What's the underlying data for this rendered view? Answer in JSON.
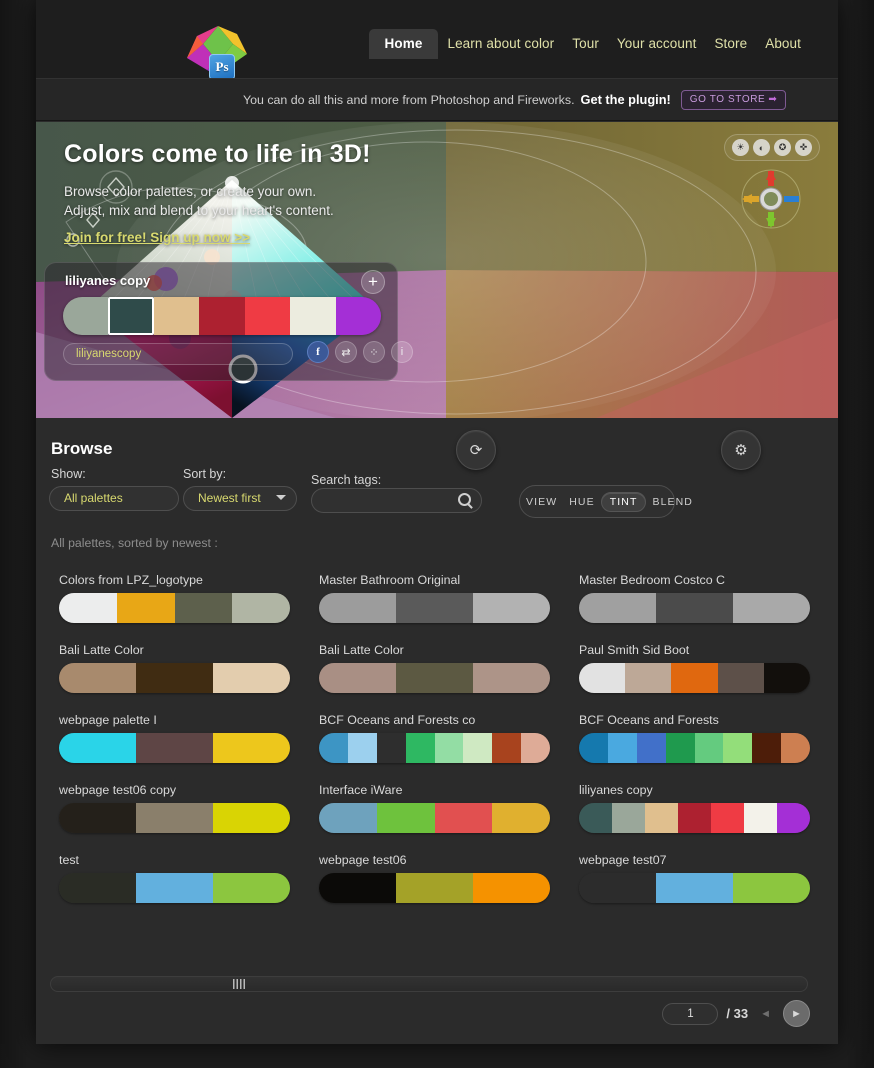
{
  "nav": {
    "items": [
      {
        "label": "Home",
        "active": true
      },
      {
        "label": "Learn about color",
        "active": false
      },
      {
        "label": "Tour",
        "active": false
      },
      {
        "label": "Your account",
        "active": false
      },
      {
        "label": "Store",
        "active": false
      },
      {
        "label": "About",
        "active": false
      }
    ]
  },
  "logo": {
    "badge": "Ps"
  },
  "plugin_bar": {
    "text": "You can do all this and more from Photoshop and Fireworks.",
    "strong": "Get the plugin!",
    "button": "GO TO STORE",
    "button_arrow": "➡"
  },
  "hero": {
    "title": "Colors come to life in 3D!",
    "sub_line1": "Browse color palettes, or create your own.",
    "sub_line2": "Adjust, mix and blend to your heart's content.",
    "join": "Join for free! Sign up now >>",
    "view_buttons": [
      {
        "name": "brightness-icon",
        "glyph": "☀"
      },
      {
        "name": "contrast-icon",
        "glyph": "◐"
      },
      {
        "name": "globe-icon",
        "glyph": "✪"
      },
      {
        "name": "rotate-icon",
        "glyph": "✜"
      }
    ]
  },
  "palette_editor": {
    "name": "liliyanes copy",
    "add_label": "+",
    "tag_value": "liliyanescopy",
    "swatches": [
      "#9aa79a",
      "#2f4b4a",
      "#e0bf8e",
      "#ad2130",
      "#ef3b44",
      "#ececdf",
      "#a42fd6"
    ],
    "selected_index": 1,
    "icons": [
      {
        "name": "facebook-icon",
        "glyph": "f"
      },
      {
        "name": "share-icon",
        "glyph": "⇄"
      },
      {
        "name": "colors-icon",
        "glyph": "⁘"
      },
      {
        "name": "info-icon",
        "glyph": "i"
      }
    ]
  },
  "browse": {
    "heading": "Browse",
    "show_label": "Show:",
    "show_value": "All palettes",
    "sort_label": "Sort by:",
    "sort_value": "Newest first",
    "search_label": "Search tags:",
    "search_value": "",
    "search_placeholder": "",
    "sorted_note": "All palettes, sorted by newest :",
    "modes": [
      {
        "label": "VIEW",
        "active": false
      },
      {
        "label": "HUE",
        "active": false
      },
      {
        "label": "TINT",
        "active": true
      },
      {
        "label": "BLEND",
        "active": false
      }
    ],
    "refresh_icon": "⟳",
    "settings_icon": "⚙"
  },
  "palettes": [
    {
      "title": "Colors from LPZ_logotype",
      "colors": [
        "#eceded",
        "#e8a716",
        "#5d604c",
        "#b0b5a4"
      ]
    },
    {
      "title": "Master Bathroom Original",
      "colors": [
        "#9c9c9c",
        "#5a5a5a",
        "#b2b2b2"
      ]
    },
    {
      "title": "Master Bedroom Costco C",
      "colors": [
        "#a0a0a0",
        "#4b4b4b",
        "#a9a9a9"
      ]
    },
    {
      "title": "Bali Latte Color",
      "colors": [
        "#a88a6d",
        "#402c12",
        "#e3cdae"
      ]
    },
    {
      "title": "Bali Latte Color",
      "colors": [
        "#a98f84",
        "#5c5942",
        "#ad9488"
      ]
    },
    {
      "title": "Paul Smith Sid Boot",
      "colors": [
        "#e2e2e2",
        "#bda897",
        "#e0680f",
        "#5d5049",
        "#120f0c"
      ]
    },
    {
      "title": "webpage palette I",
      "colors": [
        "#2ad4e8",
        "#5e4545",
        "#edc71c"
      ]
    },
    {
      "title": "BCF Oceans and Forests co",
      "colors": [
        "#3d95c4",
        "#9cd0ee",
        "#2e2e2e",
        "#2eb862",
        "#93dda4",
        "#cfe9c2",
        "#a8431e",
        "#deab97"
      ]
    },
    {
      "title": "BCF Oceans and Forests",
      "colors": [
        "#1579ae",
        "#4aa9e0",
        "#4170c9",
        "#1f9a4e",
        "#64cb7f",
        "#93de7a",
        "#4d1d09",
        "#cd7f51"
      ]
    },
    {
      "title": "webpage test06 copy",
      "colors": [
        "#24201a",
        "#8a7f6b",
        "#d9d404"
      ]
    },
    {
      "title": "Interface iWare",
      "colors": [
        "#6ea2bd",
        "#6ec23d",
        "#e15050",
        "#e0b02f"
      ]
    },
    {
      "title": "liliyanes copy",
      "colors": [
        "#3a5a58",
        "#9aa79a",
        "#e0bf8e",
        "#ad2130",
        "#ef3b44",
        "#f3f2ea",
        "#a42fd6"
      ]
    },
    {
      "title": "test",
      "colors": [
        "#2a2c25",
        "#62b0de",
        "#8cc63f"
      ]
    },
    {
      "title": "webpage test06",
      "colors": [
        "#0b0a08",
        "#a4a228",
        "#f59200"
      ]
    },
    {
      "title": "webpage test07",
      "colors": [
        "#2c2c2c",
        "#62b0de",
        "#8cc63f"
      ]
    }
  ],
  "pagination": {
    "current_page": "1",
    "separator": "/",
    "total_pages": "33",
    "prev_glyph": "◄",
    "next_glyph": "►"
  }
}
